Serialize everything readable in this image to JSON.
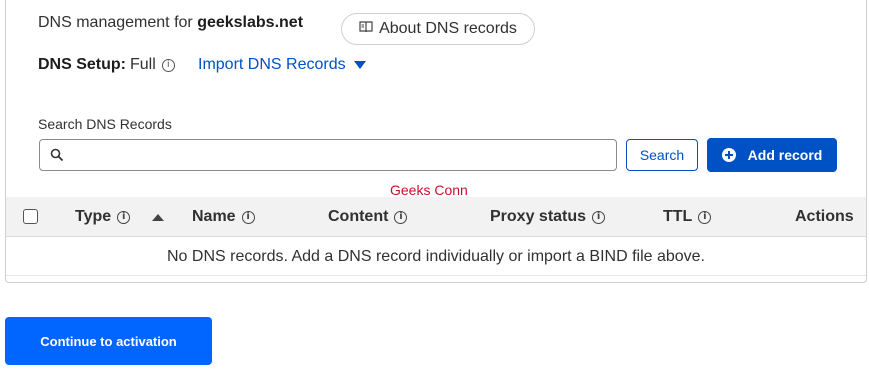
{
  "header": {
    "mgmt_prefix": "DNS management for ",
    "domain": "geekslabs.net",
    "about_label": "About DNS records"
  },
  "setup": {
    "label": "DNS Setup:",
    "value": "Full",
    "import_label": "Import DNS Records"
  },
  "search": {
    "label": "Search DNS Records",
    "value": "",
    "placeholder": "",
    "button_label": "Search"
  },
  "add_record_label": "Add record",
  "watermark": "Geeks Conn",
  "table": {
    "columns": [
      "Type",
      "Name",
      "Content",
      "Proxy status",
      "TTL",
      "Actions"
    ],
    "empty_message": "No DNS records. Add a DNS record individually or import a BIND file above."
  },
  "continue_label": "Continue to activation",
  "colors": {
    "accent": "#0051c3",
    "primary_button": "#0066ff",
    "watermark": "#c8102e"
  }
}
